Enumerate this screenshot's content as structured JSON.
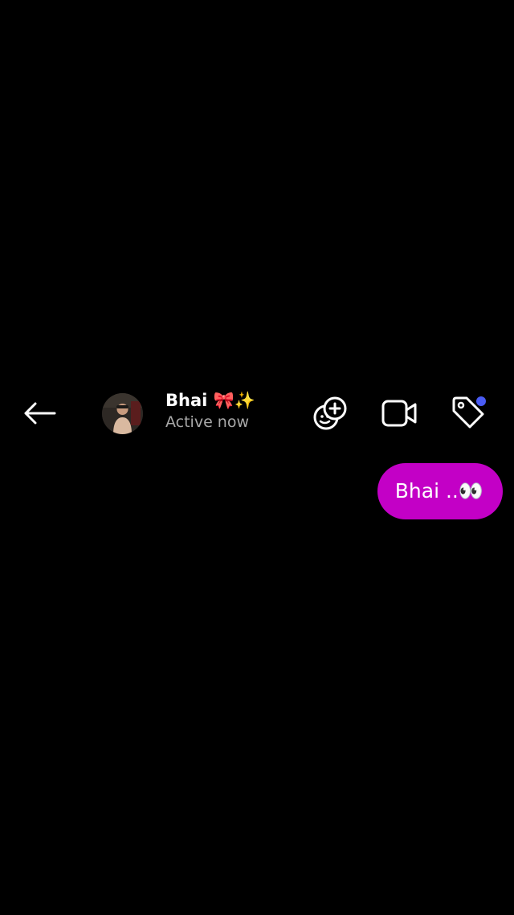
{
  "header": {
    "contact_name": "Bhai 🎀✨",
    "status": "Active now"
  },
  "icons": {
    "back": "arrow-left-icon",
    "sticker": "sticker-add-icon",
    "video": "video-call-icon",
    "tag": "tag-icon"
  },
  "colors": {
    "background": "#000000",
    "bubble": "#c300c6",
    "status_text": "#a8a8a8",
    "notification_dot": "#4a5cf4"
  },
  "messages": [
    {
      "sender": "me",
      "text": "Bhai ..👀"
    }
  ]
}
